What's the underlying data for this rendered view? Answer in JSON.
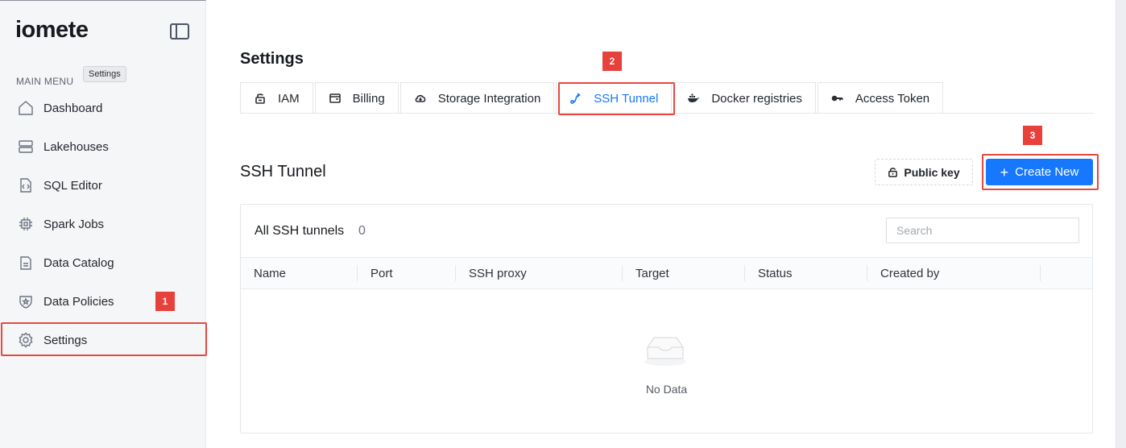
{
  "app": {
    "logo": "iomete"
  },
  "sidebar": {
    "caption": "MAIN MENU",
    "tooltip": "Settings",
    "items": [
      {
        "label": "Dashboard",
        "icon": "home-icon"
      },
      {
        "label": "Lakehouses",
        "icon": "server-icon"
      },
      {
        "label": "SQL Editor",
        "icon": "code-file-icon"
      },
      {
        "label": "Spark Jobs",
        "icon": "chip-icon"
      },
      {
        "label": "Data Catalog",
        "icon": "document-icon"
      },
      {
        "label": "Data Policies",
        "icon": "shield-star-icon"
      },
      {
        "label": "Settings",
        "icon": "gear-icon"
      }
    ]
  },
  "page": {
    "title": "Settings"
  },
  "tabs": [
    {
      "label": "IAM",
      "icon": "lock-icon"
    },
    {
      "label": "Billing",
      "icon": "wallet-icon"
    },
    {
      "label": "Storage Integration",
      "icon": "cloud-download-icon"
    },
    {
      "label": "SSH Tunnel",
      "icon": "route-icon",
      "active": true
    },
    {
      "label": "Docker registries",
      "icon": "docker-icon"
    },
    {
      "label": "Access Token",
      "icon": "key-icon"
    }
  ],
  "section": {
    "title": "SSH Tunnel",
    "public_key_label": "Public key",
    "create_label": "Create New"
  },
  "table": {
    "title": "All SSH tunnels",
    "count": "0",
    "search_placeholder": "Search",
    "columns": [
      "Name",
      "Port",
      "SSH proxy",
      "Target",
      "Status",
      "Created by"
    ],
    "empty_text": "No Data"
  },
  "annotations": [
    "1",
    "2",
    "3"
  ],
  "colors": {
    "accent": "#1677ff",
    "highlight": "#e8473f",
    "sidebar_bg": "#f5f6f8"
  }
}
